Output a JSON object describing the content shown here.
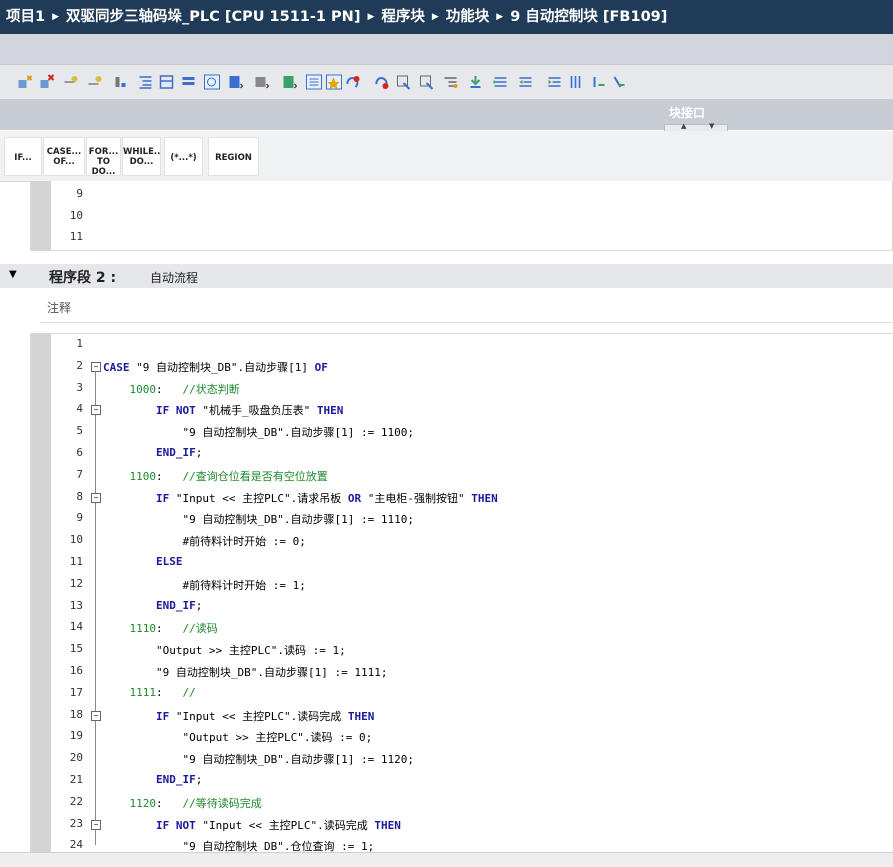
{
  "breadcrumb": [
    "项目1",
    "双驱同步三轴码垛_PLC [CPU 1511-1 PN]",
    "程序块",
    "功能块",
    "9 自动控制块 [FB109]"
  ],
  "breadcrumb_separator": "▶",
  "toolbar_icons": [
    "insert-network-icon",
    "delete-network-icon",
    "insert-row-icon",
    "append-row-icon",
    "expand-icon",
    "indent-icon",
    "collapse-all-icon",
    "expand-all-icon",
    "comment-icon",
    "absolute-operand-icon",
    "symbol-info-icon",
    "show-overview-icon",
    "network-comment-icon",
    "favorites-icon",
    "go-to-error-icon",
    "go-to-next-error-icon",
    "comment-line-icon",
    "uncomment-line-icon",
    "indent-line-icon",
    "increase-indent-icon",
    "decrease-indent-icon",
    "outdent-icon",
    "bookmark-icon",
    "next-bookmark-icon",
    "prev-bookmark-icon",
    "monitor-icon"
  ],
  "block_interface_label": "块接口",
  "instructions": [
    {
      "line1": "IF...",
      "line2": ""
    },
    {
      "line1": "CASE...",
      "line2": "OF..."
    },
    {
      "line1": "FOR...",
      "line2": "TO DO..."
    },
    {
      "line1": "WHILE..",
      "line2": "DO..."
    },
    {
      "line1": "(*...*)",
      "line2": ""
    },
    {
      "line1": "REGION",
      "line2": ""
    }
  ],
  "segment1": {
    "lines": [
      {
        "n": "9",
        "text": ""
      },
      {
        "n": "10",
        "text": ""
      },
      {
        "n": "11",
        "text": ""
      }
    ]
  },
  "segment2": {
    "label": "程序段 2 :",
    "title": "自动流程",
    "comment": "注释",
    "lines": [
      {
        "n": "1",
        "text": ""
      },
      {
        "n": "2",
        "text": "CASE \"9 自动控制块_DB\".自动步骤[1] OF"
      },
      {
        "n": "3",
        "text": "    1000:   //状态判断"
      },
      {
        "n": "4",
        "text": "        IF NOT \"机械手_吸盘负压表\" THEN"
      },
      {
        "n": "5",
        "text": "            \"9 自动控制块_DB\".自动步骤[1] := 1100;"
      },
      {
        "n": "6",
        "text": "        END_IF;"
      },
      {
        "n": "7",
        "text": "    1100:   //查询仓位看是否有空位放置"
      },
      {
        "n": "8",
        "text": "        IF \"Input << 主控PLC\".请求吊板 OR \"主电柜-强制按钮\" THEN"
      },
      {
        "n": "9",
        "text": "            \"9 自动控制块_DB\".自动步骤[1] := 1110;"
      },
      {
        "n": "10",
        "text": "            #前待料计时开始 := 0;"
      },
      {
        "n": "11",
        "text": "        ELSE"
      },
      {
        "n": "12",
        "text": "            #前待料计时开始 := 1;"
      },
      {
        "n": "13",
        "text": "        END_IF;"
      },
      {
        "n": "14",
        "text": "    1110:   //读码"
      },
      {
        "n": "15",
        "text": "        \"Output >> 主控PLC\".读码 := 1;"
      },
      {
        "n": "16",
        "text": "        \"9 自动控制块_DB\".自动步骤[1] := 1111;"
      },
      {
        "n": "17",
        "text": "    1111:   //"
      },
      {
        "n": "18",
        "text": "        IF \"Input << 主控PLC\".读码完成 THEN"
      },
      {
        "n": "19",
        "text": "            \"Output >> 主控PLC\".读码 := 0;"
      },
      {
        "n": "20",
        "text": "            \"9 自动控制块_DB\".自动步骤[1] := 1120;"
      },
      {
        "n": "21",
        "text": "        END_IF;"
      },
      {
        "n": "22",
        "text": "    1120:   //等待读码完成"
      },
      {
        "n": "23",
        "text": "        IF NOT \"Input << 主控PLC\".读码完成 THEN"
      },
      {
        "n": "24",
        "text": "            \"9 自动控制块_DB\".仓位查询 := 1;"
      }
    ]
  },
  "colors": {
    "titlebar": "#1f3b57",
    "keyword": "#1a1a9e",
    "comment": "#1f8a2b"
  }
}
